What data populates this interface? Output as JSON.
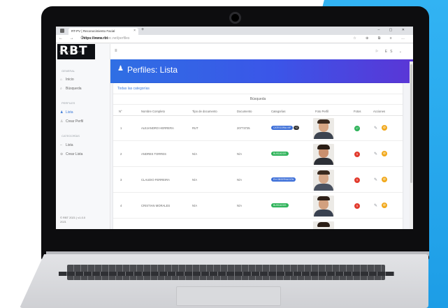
{
  "browser": {
    "tab_title": "RT-PV | Reconocimiento Facial",
    "new_tab": "+",
    "window_controls": "–  ▢  ✕",
    "nav_buttons": "←  →  C",
    "url_bold": "https://www.",
    "url_domain": "rbt",
    "url_rest": "ec.net/perfiles",
    "address_icons": "☆  ⊕  ⧉  ≡  …"
  },
  "app": {
    "logo_text": "RBT",
    "logo_sub": "TECNOLOGIAS",
    "hamburger": "≡",
    "topbar_right": "⚐  ES ⌄",
    "sidebar": {
      "section1": "GENERAL",
      "item_inicio": "Inicio",
      "item_busqueda": "Búsqueda",
      "section2": "PERFILES",
      "item_lista": "Lista",
      "item_crear_perfil": "Crear Perfil",
      "section3": "CATEGORÍAS",
      "item_lista2": "Lista",
      "item_crear": "Crear Lista",
      "footer_line1": "© RBT 2021 | v1.0.0",
      "footer_line2": "2021"
    },
    "header": {
      "icon": "♟",
      "title": "Perfiles: Lista"
    },
    "filter_link": "Todas las categorías",
    "search_label": "Búsqueda",
    "columns": [
      "N°",
      "Nombre Completo",
      "Tipo de documento",
      "Documento",
      "Categorías",
      "Foto Perfil",
      "Fotos",
      "Acciones"
    ],
    "rows": [
      {
        "n": "1",
        "name": "ALEJANDRO HERRERA",
        "doc_type": "RUT",
        "doc": "20773725",
        "cat": "CATEGORIA VIP",
        "cat_color": "#3d6fd8",
        "extra": "+2",
        "photos": "17",
        "photos_color": "#2fb35a"
      },
      {
        "n": "2",
        "name": "ANDRES TORRES",
        "doc_type": "N/A",
        "doc": "N/A",
        "cat": "BUSCADOS",
        "cat_color": "#2fb35a",
        "extra": "",
        "photos": "5",
        "photos_color": "#e23b2e"
      },
      {
        "n": "3",
        "name": "CLAUDIO FERREIRA",
        "doc_type": "N/A",
        "doc": "N/A",
        "cat": "EN OBSERVACIÓN",
        "cat_color": "#3d6fd8",
        "extra": "",
        "photos": "5",
        "photos_color": "#e23b2e"
      },
      {
        "n": "4",
        "name": "CRISTIAN MORALES",
        "doc_type": "N/A",
        "doc": "N/A",
        "cat": "BUSCADOS",
        "cat_color": "#2fb35a",
        "extra": "",
        "photos": "5",
        "photos_color": "#e23b2e"
      }
    ],
    "action_edit_icon": "✎",
    "action_delete_icon": "⊘"
  }
}
